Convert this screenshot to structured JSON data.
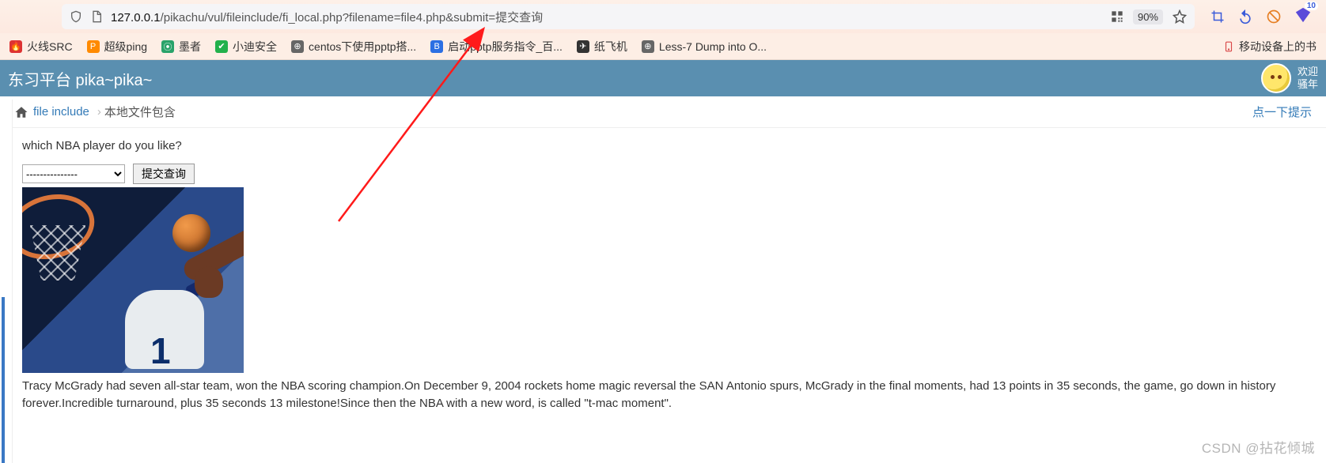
{
  "url": {
    "host": "127.0.0.1",
    "path": "/pikachu/vul/fileinclude/fi_local.php?filename=file4.php&submit=提交查询"
  },
  "zoom": "90%",
  "ext_badge": "10",
  "bookmarks": [
    {
      "label": "火线SRC",
      "icon": "🔥",
      "bg": "#d33"
    },
    {
      "label": "超级ping",
      "icon": "P",
      "bg": "#ff8a00"
    },
    {
      "label": "墨者",
      "icon": "墨",
      "bg": "#2aa36a",
      "txt": "#fff"
    },
    {
      "label": "小迪安全",
      "icon": "✔",
      "bg": "#22b14c"
    },
    {
      "label": "centos下使用pptp搭...",
      "icon": "⊕",
      "bg": "#666"
    },
    {
      "label": "启动pptp服务指令_百...",
      "icon": "B",
      "bg": "#2b6fe3"
    },
    {
      "label": "纸飞机",
      "icon": "✈",
      "bg": "#333"
    },
    {
      "label": "Less-7 Dump into O...",
      "icon": "⊕",
      "bg": "#666"
    }
  ],
  "bookmark_right": "移动设备上的书",
  "banner": {
    "title": "东习平台 pika~pika~",
    "welcome_l1": "欢迎",
    "welcome_l2": "骚年"
  },
  "crumb": {
    "link": "file include",
    "current": "本地文件包含",
    "hint": "点一下提示"
  },
  "content": {
    "question": "which NBA player do you like?",
    "select_placeholder": "---------------",
    "submit": "提交查询",
    "jersey_no": "1",
    "desc": "Tracy McGrady had seven all-star team, won the NBA scoring champion.On December 9, 2004 rockets home magic reversal the SAN Antonio spurs, McGrady in the final moments, had 13 points in 35 seconds, the game, go down in history forever.Incredible turnaround, plus 35 seconds 13 milestone!Since then the NBA with a new word, is called \"t-mac moment\"."
  },
  "watermark": "CSDN @拈花倾城"
}
